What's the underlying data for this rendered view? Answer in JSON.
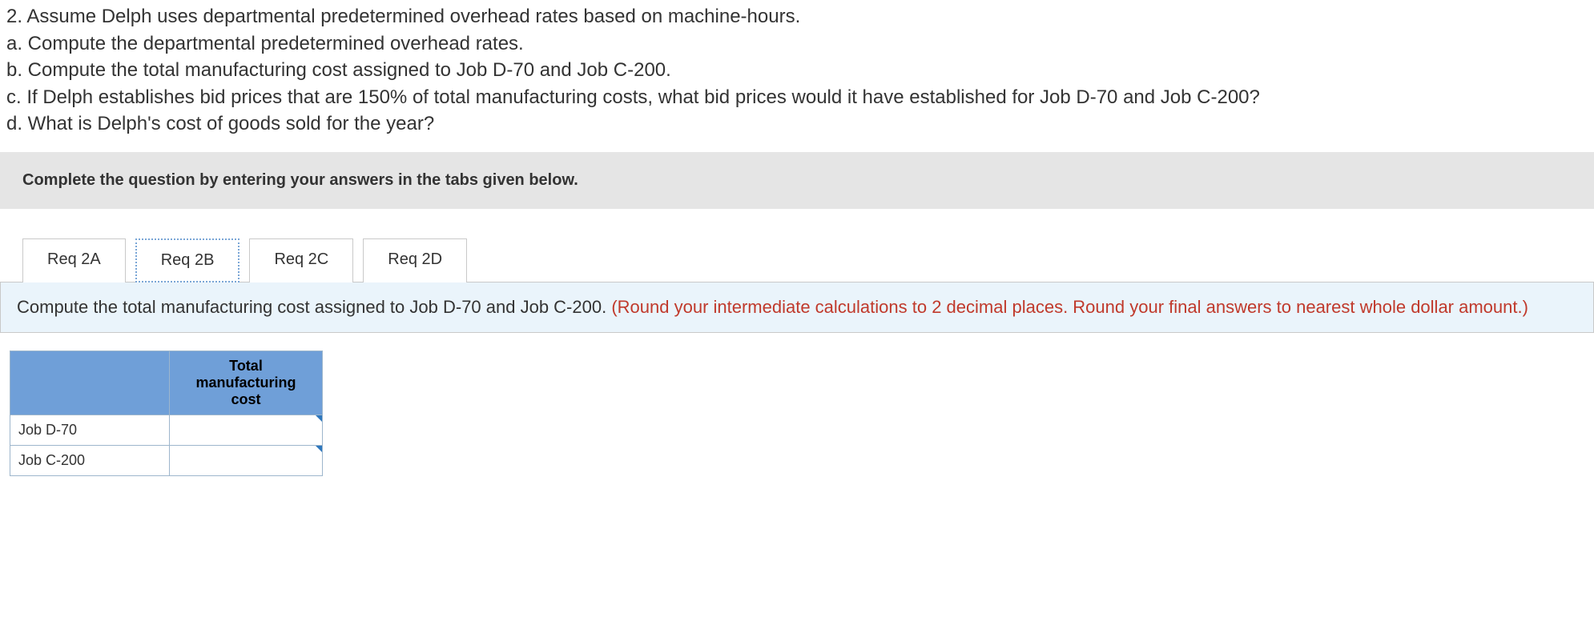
{
  "question": {
    "stem": "2. Assume Delph uses departmental predetermined overhead rates based on machine-hours.",
    "a": "a. Compute the  departmental  predetermined overhead rates.",
    "b": "b. Compute the total manufacturing cost assigned to Job D-70 and Job C-200.",
    "c": "c. If Delph establishes bid prices that are 150% of total manufacturing costs, what bid prices would it have established for Job D-70 and Job C-200?",
    "d": "d. What is Delph's cost of goods sold for the year?"
  },
  "instruction": "Complete the question by entering your answers in the tabs given below.",
  "tabs": {
    "a": "Req 2A",
    "b": "Req 2B",
    "c": "Req 2C",
    "d": "Req 2D"
  },
  "prompt": {
    "main": "Compute the total manufacturing cost assigned to Job D-70 and Job C-200. ",
    "hint": "(Round your intermediate calculations to 2 decimal places. Round your final answers to nearest whole dollar amount.)"
  },
  "table": {
    "header": "Total manufacturing cost",
    "rows": [
      {
        "label": "Job D-70",
        "value": ""
      },
      {
        "label": "Job C-200",
        "value": ""
      }
    ]
  }
}
